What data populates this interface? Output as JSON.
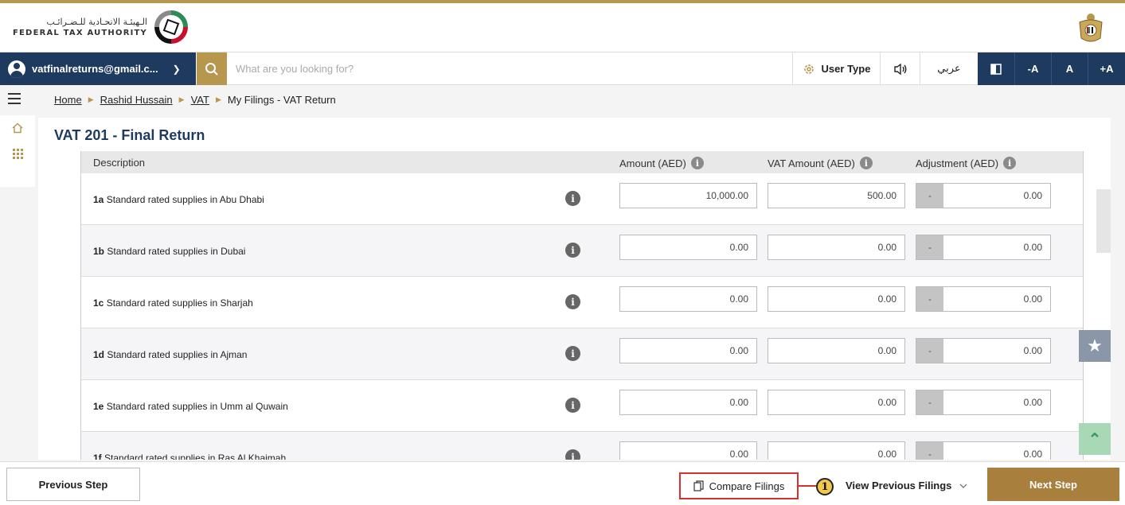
{
  "header": {
    "logo_arabic": "الـهيئـة الاتحـادية للـضـرائـب",
    "logo_english": "FEDERAL TAX AUTHORITY"
  },
  "navbar": {
    "user_email": "vatfinalreturns@gmail.c...",
    "search_placeholder": "What are you looking for?",
    "user_type_label": "User Type",
    "arabic_label": "عربي",
    "font_decrease": "-A",
    "font_normal": "A",
    "font_increase": "+A"
  },
  "breadcrumb": {
    "items": [
      "Home",
      "Rashid Hussain",
      "VAT"
    ],
    "current": "My Filings - VAT Return"
  },
  "page": {
    "title": "VAT 201 - Final Return"
  },
  "table": {
    "headers": {
      "description": "Description",
      "amount": "Amount (AED)",
      "vat_amount": "VAT Amount (AED)",
      "adjustment": "Adjustment (AED)"
    },
    "rows": [
      {
        "code": "1a",
        "label": "Standard rated supplies in Abu Dhabi",
        "amount": "10,000.00",
        "vat": "500.00",
        "sign": "-",
        "adjustment": "0.00"
      },
      {
        "code": "1b",
        "label": "Standard rated supplies in Dubai",
        "amount": "0.00",
        "vat": "0.00",
        "sign": "-",
        "adjustment": "0.00"
      },
      {
        "code": "1c",
        "label": "Standard rated supplies in Sharjah",
        "amount": "0.00",
        "vat": "0.00",
        "sign": "-",
        "adjustment": "0.00"
      },
      {
        "code": "1d",
        "label": "Standard rated supplies in Ajman",
        "amount": "0.00",
        "vat": "0.00",
        "sign": "-",
        "adjustment": "0.00"
      },
      {
        "code": "1e",
        "label": "Standard rated supplies in Umm al Quwain",
        "amount": "0.00",
        "vat": "0.00",
        "sign": "-",
        "adjustment": "0.00"
      },
      {
        "code": "1f",
        "label": "Standard rated supplies in Ras Al Khaimah",
        "amount": "0.00",
        "vat": "0.00",
        "sign": "-",
        "adjustment": "0.00"
      }
    ]
  },
  "footer": {
    "previous_label": "Previous Step",
    "compare_label": "Compare Filings",
    "callout_number": "1",
    "view_previous_label": "View Previous Filings",
    "next_label": "Next Step"
  },
  "colors": {
    "navy": "#1e3a5f",
    "gold": "#b7964e",
    "next_button": "#a87f3c",
    "highlight_red": "#d9302c"
  }
}
